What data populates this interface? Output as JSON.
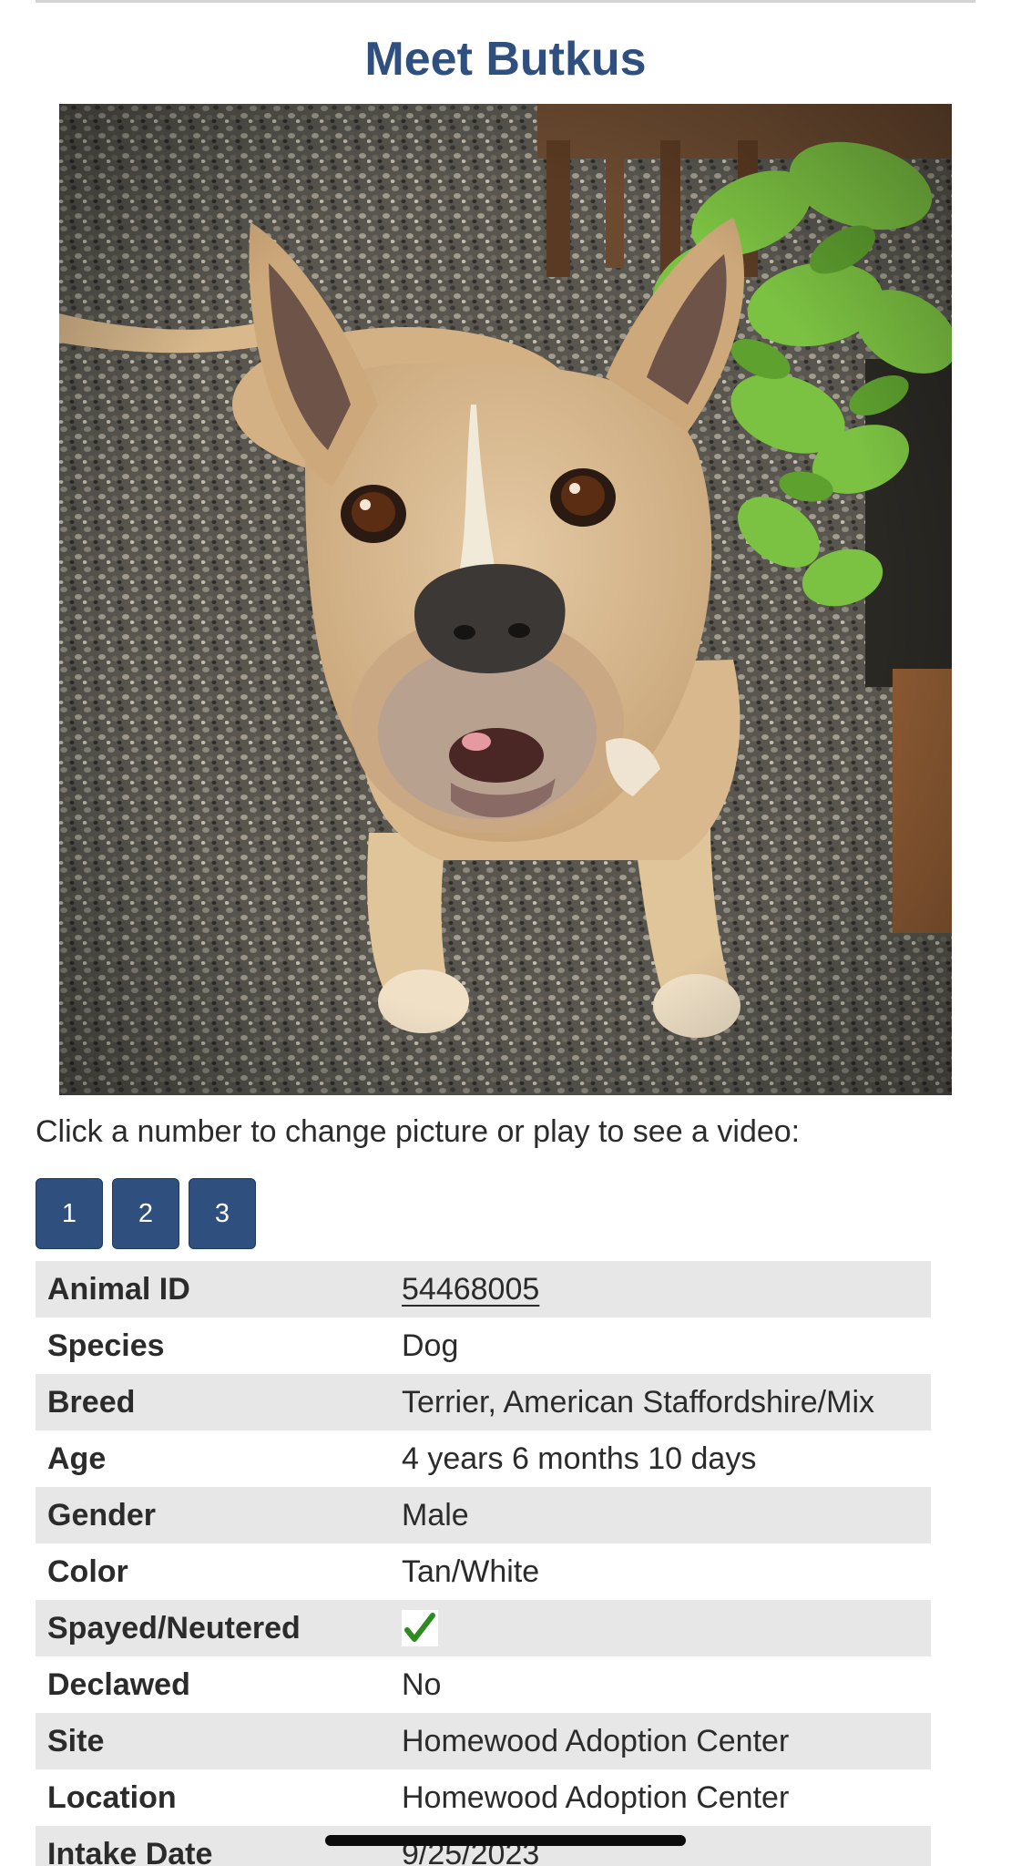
{
  "page": {
    "title": "Meet Butkus"
  },
  "photo": {
    "alt": "Photo of Butkus",
    "subject_icon": "dog-photo"
  },
  "pager": {
    "instructions": "Click a number to change picture or play to see a video:",
    "buttons": [
      "1",
      "2",
      "3"
    ]
  },
  "details": {
    "rows": [
      {
        "label": "Animal ID",
        "value": "54468005"
      },
      {
        "label": "Species",
        "value": "Dog"
      },
      {
        "label": "Breed",
        "value": "Terrier, American Staffordshire/Mix"
      },
      {
        "label": "Age",
        "value": "4 years 6 months 10 days"
      },
      {
        "label": "Gender",
        "value": "Male"
      },
      {
        "label": "Color",
        "value": "Tan/White"
      },
      {
        "label": "Spayed/Neutered",
        "value": "",
        "icon": "checkmark-icon"
      },
      {
        "label": "Declawed",
        "value": "No"
      },
      {
        "label": "Site",
        "value": "Homewood Adoption Center"
      },
      {
        "label": "Location",
        "value": "Homewood Adoption Center"
      },
      {
        "label": "Intake Date",
        "value": "9/25/2023"
      }
    ]
  },
  "colors": {
    "accent": "#2f4f7f",
    "row_shade": "#e7e7e7",
    "check": "#2e8b1f"
  }
}
